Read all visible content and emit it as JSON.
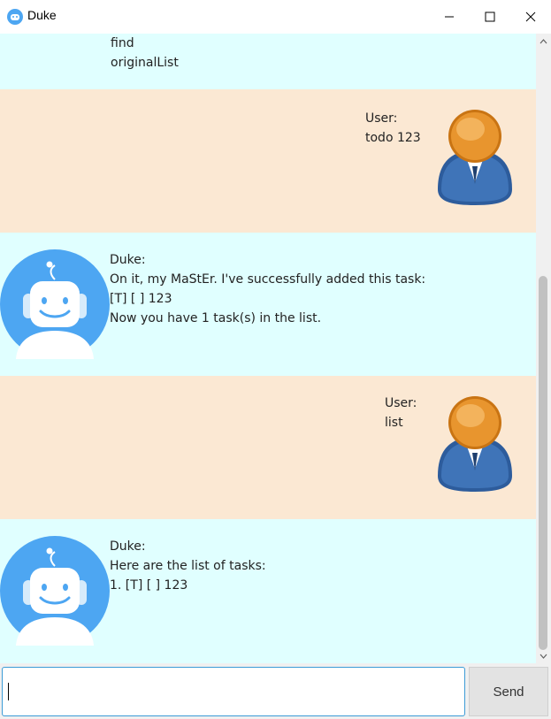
{
  "window": {
    "title": "Duke"
  },
  "colors": {
    "duke_bg": "#e0ffff",
    "user_bg": "#fbe8d3",
    "accent": "#3c9bd6",
    "duke_avatar": "#4da6f2",
    "user_avatar": "#e8952e"
  },
  "messages": [
    {
      "sender": "duke",
      "lines": [
        "find",
        "originalList"
      ]
    },
    {
      "sender": "user",
      "lines": [
        "User:",
        "todo 123"
      ]
    },
    {
      "sender": "duke",
      "lines": [
        "Duke:",
        "On it, my MaStEr. I've successfully added this task:",
        "[T] [ ] 123",
        "Now you have 1 task(s) in the list."
      ]
    },
    {
      "sender": "user",
      "lines": [
        "User:",
        "list"
      ]
    },
    {
      "sender": "duke",
      "lines": [
        "Duke:",
        "Here are the list of tasks:",
        "1. [T] [ ] 123"
      ]
    }
  ],
  "input": {
    "value": "",
    "placeholder": ""
  },
  "send_label": "Send"
}
